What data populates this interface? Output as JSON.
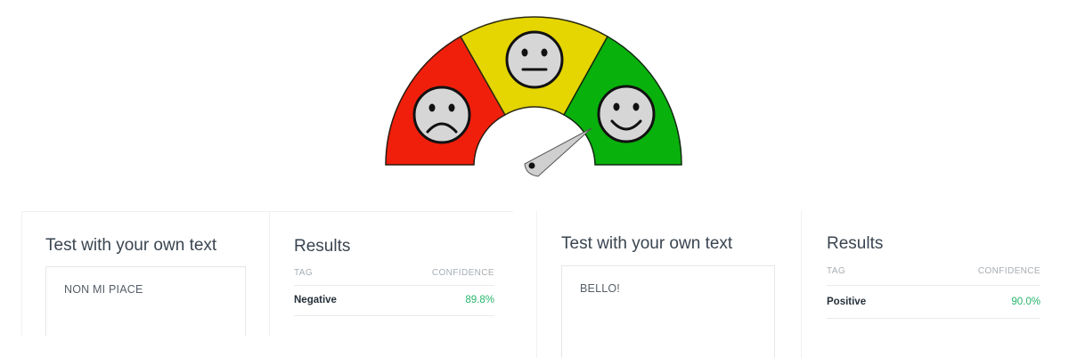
{
  "gauge": {
    "segments": [
      {
        "name": "negative",
        "color": "#f01f0c",
        "face": "frown-face-icon"
      },
      {
        "name": "neutral",
        "color": "#e5d500",
        "face": "neutral-face-icon"
      },
      {
        "name": "positive",
        "color": "#09b10c",
        "face": "smile-face-icon"
      }
    ],
    "needle_color": "#c9c9c9"
  },
  "left_card": {
    "title": "Test with your own text",
    "input_value": "NON MI PIACE",
    "results_title": "Results",
    "col_tag": "TAG",
    "col_confidence": "CONFIDENCE",
    "result": {
      "tag": "Negative",
      "confidence": "89.8%"
    }
  },
  "right_card": {
    "title": "Test with your own text",
    "input_value": "BELLO!",
    "results_title": "Results",
    "col_tag": "TAG",
    "col_confidence": "CONFIDENCE",
    "result": {
      "tag": "Positive",
      "confidence": "90.0%"
    }
  },
  "colors": {
    "confidence_green": "#27b56a"
  }
}
